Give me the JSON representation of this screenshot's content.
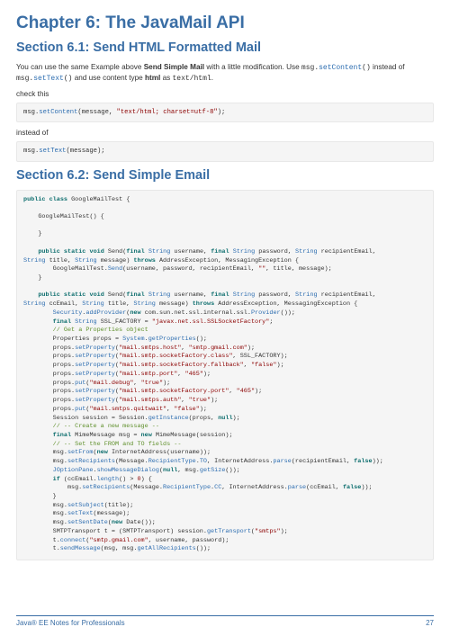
{
  "chapter_title": "Chapter 6: The JavaMail API",
  "section61_title": "Section 6.1: Send HTML Formatted Mail",
  "intro_part1": "You can use the same Example above ",
  "intro_bold": "Send Simple Mail",
  "intro_part2": " with a little modification. Use ",
  "intro_code1a": "msg.",
  "intro_code1b": "setContent",
  "intro_code1c": "()",
  "intro_part3": " instead of ",
  "intro_code2a": "msg.",
  "intro_code2b": "setText",
  "intro_code2c": "()",
  "intro_part4": " and use content type ",
  "intro_bold2": "html",
  "intro_part5": " as ",
  "intro_code3": "text/html",
  "intro_part6": ".",
  "label_check": "check this",
  "label_instead": "instead of",
  "section62_title": "Section 6.2: Send Simple Email",
  "footer_left": "Java® EE Notes for Professionals",
  "footer_right": "27",
  "code1": {
    "p_msg": "msg.",
    "p_method": "setContent",
    "p_open": "(message, ",
    "p_str": "\"text/html; charset=utf-8\"",
    "p_close": ");"
  },
  "code2": {
    "p_msg": "msg.",
    "p_method": "setText",
    "p_open": "(message);"
  },
  "code3": {
    "kw_public": "public",
    "kw_class": "class",
    "kw_static": "static",
    "kw_void": "void",
    "kw_final": "final",
    "kw_throws": "throws",
    "kw_new": "new",
    "kw_null": "null",
    "kw_if": "if",
    "kw_false": "false",
    "kw_true": "true",
    "id_googlemailtest": "GoogleMailTest",
    "id_send": "Send",
    "id_string": "String",
    "id_security": "Security",
    "id_system": "System",
    "id_joptionpane": "JOptionPane",
    "c_getprops": "// Get a Properties object",
    "c_create": "// -- Create a new message --",
    "c_fromto": "// -- Set the FROM and TO fields --",
    "s1": "\"javax.net.ssl.SSLSocketFactory\"",
    "s2": "\"mail.smtps.host\"",
    "s3": "\"smtp.gmail.com\"",
    "s4": "\"mail.smtp.socketFactory.class\"",
    "s5": "\"mail.smtp.socketFactory.fallback\"",
    "s6": "\"false\"",
    "s7": "\"mail.smtp.port\"",
    "s8": "\"465\"",
    "s9": "\"mail.debug\"",
    "s10": "\"true\"",
    "s11": "\"mail.smtp.socketFactory.port\"",
    "s12": "\"mail.smtps.auth\"",
    "s13": "\"mail.smtps.quitwait\"",
    "s14": "\"smtps\"",
    "s15": "\"smtp.gmail.com\"",
    "s16": "\"\"",
    "n0": "0",
    "id_sendcall": "Send",
    "id_addprov": "addProvider",
    "id_getprops": "getProperties",
    "id_setprop": "setProperty",
    "id_put": "put",
    "id_getinstance": "getInstance",
    "id_setfrom": "setFrom",
    "id_setrecip": "setRecipients",
    "id_show": "showMessageDialog",
    "id_length": "length",
    "id_setsubj": "setSubject",
    "id_settext": "setText",
    "id_setsent": "setSentDate",
    "id_gettrans": "getTransport",
    "id_connect": "connect",
    "id_sendmsg": "sendMessage",
    "id_getall": "getAllRecipients",
    "id_parse": "parse",
    "id_getsize": "getSize",
    "id_to": "TO",
    "id_cc": "CC",
    "id_rectype": "RecipientType",
    "id_provider": "Provider"
  }
}
